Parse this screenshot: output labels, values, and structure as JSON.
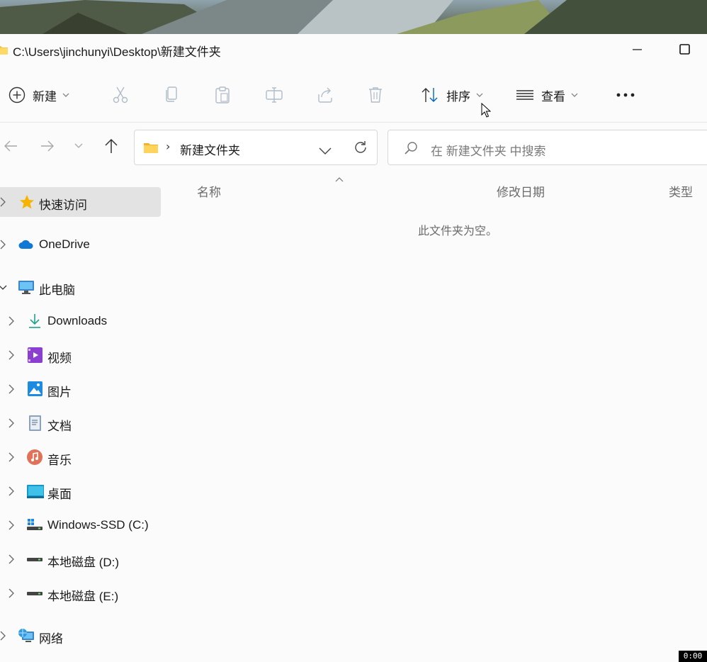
{
  "window": {
    "title": "C:\\Users\\jinchunyi\\Desktop\\新建文件夹"
  },
  "toolbar": {
    "new_label": "新建",
    "sort_label": "排序",
    "view_label": "查看"
  },
  "address": {
    "separator": "›",
    "path": "新建文件夹"
  },
  "search": {
    "placeholder": "在 新建文件夹 中搜索"
  },
  "sidebar": {
    "items": [
      {
        "label": "快速访问"
      },
      {
        "label": "OneDrive"
      },
      {
        "label": "此电脑"
      },
      {
        "label": "Downloads"
      },
      {
        "label": "视频"
      },
      {
        "label": "图片"
      },
      {
        "label": "文档"
      },
      {
        "label": "音乐"
      },
      {
        "label": "桌面"
      },
      {
        "label": "Windows-SSD (C:)"
      },
      {
        "label": "本地磁盘 (D:)"
      },
      {
        "label": "本地磁盘 (E:)"
      },
      {
        "label": "网络"
      }
    ]
  },
  "columns": {
    "name": "名称",
    "modified": "修改日期",
    "type": "类型"
  },
  "empty_message": "此文件夹为空。",
  "recording_timer": "0:00",
  "colors": {
    "accent": "#0067c0",
    "selected_bg": "#e3e3e3",
    "folder_yellow": "#f6c445"
  }
}
